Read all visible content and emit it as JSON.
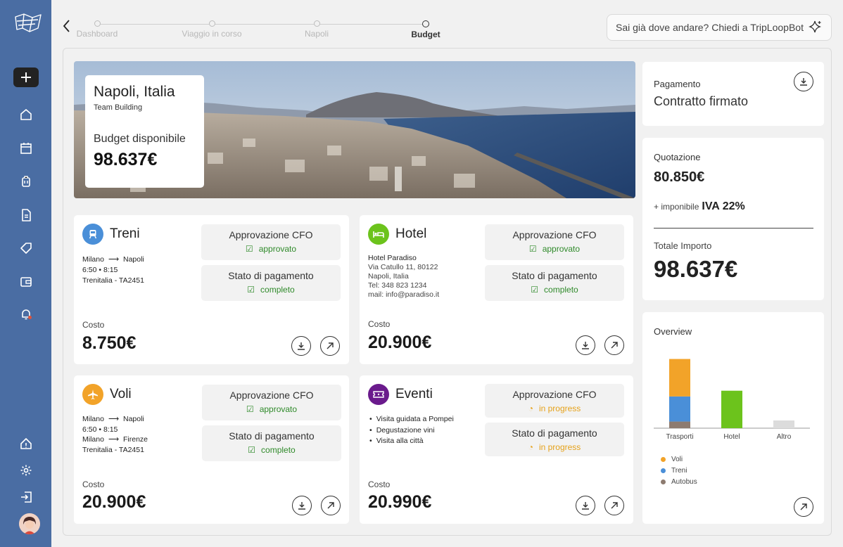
{
  "stepper": {
    "steps": [
      "Dashboard",
      "Viaggio in corso",
      "Napoli",
      "Budget"
    ],
    "active": "Budget"
  },
  "assistant": {
    "prompt": "Sai già dove andare? Chiedi a TripLoopBot"
  },
  "hero": {
    "city": "Napoli, Italia",
    "subtitle": "Team Building",
    "budget_label": "Budget disponibile",
    "budget_value": "98.637€"
  },
  "cards": {
    "treni": {
      "title": "Treni",
      "from": "Milano",
      "to": "Napoli",
      "time": "6:50 • 8:15",
      "carrier": "Trenitalia - TA2451",
      "approval_label": "Approvazione CFO",
      "approval_status": "approvato",
      "payment_label": "Stato di pagamento",
      "payment_status": "completo",
      "cost_label": "Costo",
      "cost": "8.750€"
    },
    "hotel": {
      "title": "Hotel",
      "name": "Hotel Paradiso",
      "address": "Via Catullo 11, 80122",
      "city": "Napoli, Italia",
      "tel": "Tel: 348 823 1234",
      "mail": "mail: info@paradiso.it",
      "approval_label": "Approvazione CFO",
      "approval_status": "approvato",
      "payment_label": "Stato di pagamento",
      "payment_status": "completo",
      "cost_label": "Costo",
      "cost": "20.900€"
    },
    "voli": {
      "title": "Voli",
      "leg1_from": "Milano",
      "leg1_to": "Napoli",
      "time": "6:50 • 8:15",
      "leg2_from": "Milano",
      "leg2_to": "Firenze",
      "carrier": "Trenitalia - TA2451",
      "approval_label": "Approvazione CFO",
      "approval_status": "approvato",
      "payment_label": "Stato di pagamento",
      "payment_status": "completo",
      "cost_label": "Costo",
      "cost": "20.900€"
    },
    "eventi": {
      "title": "Eventi",
      "items": [
        "Visita guidata a Pompei",
        "Degustazione vini",
        "Visita alla città"
      ],
      "approval_label": "Approvazione CFO",
      "approval_status": "in progress",
      "payment_label": "Stato di pagamento",
      "payment_status": "in progress",
      "cost_label": "Costo",
      "cost": "20.990€"
    }
  },
  "payment": {
    "label": "Pagamento",
    "value": "Contratto firmato"
  },
  "quote": {
    "label": "Quotazione",
    "value": "80.850€",
    "tax_prefix": "+ imponibile",
    "tax_value": "IVA 22%",
    "total_label": "Totale Importo",
    "total_value": "98.637€"
  },
  "overview": {
    "title": "Overview",
    "legend": [
      {
        "name": "Voli",
        "color": "#f2a329"
      },
      {
        "name": "Treni",
        "color": "#4a8fd8"
      },
      {
        "name": "Autobus",
        "color": "#8d7b70"
      }
    ]
  },
  "chart_data": {
    "type": "bar",
    "categories": [
      "Trasporti",
      "Hotel",
      "Altro"
    ],
    "series": [
      {
        "name": "Voli",
        "values": [
          20.9,
          0,
          0
        ],
        "color": "#f2a329"
      },
      {
        "name": "Treni",
        "values": [
          14.0,
          0,
          0
        ],
        "color": "#4a8fd8"
      },
      {
        "name": "Autobus",
        "values": [
          3.7,
          0,
          0
        ],
        "color": "#8d7b70"
      },
      {
        "name": "",
        "values": [
          0,
          20.9,
          0
        ],
        "color": "#6cc31c"
      },
      {
        "name": "",
        "values": [
          0,
          0,
          4.3
        ],
        "color": "#dcdcdc"
      }
    ],
    "stacked": true,
    "ylim": [
      0,
      40
    ],
    "grid": false,
    "legend_position": "bottom-left"
  }
}
